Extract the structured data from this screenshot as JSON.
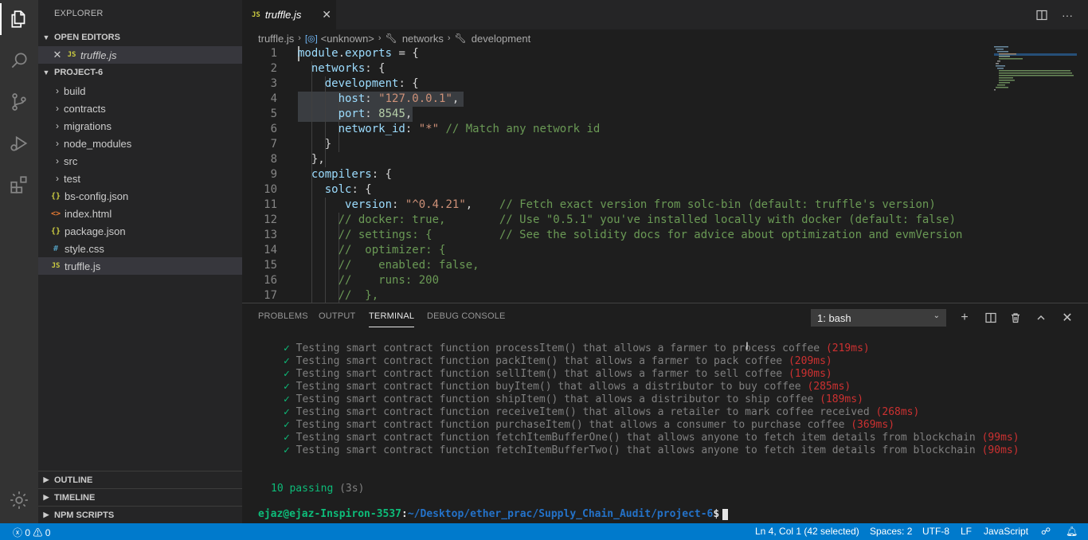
{
  "activity_bar": {
    "items": [
      "explorer-icon",
      "search-icon",
      "source-control-icon",
      "run-debug-icon",
      "extensions-icon"
    ],
    "bottom": "manage-gear-icon"
  },
  "sidebar": {
    "title": "EXPLORER",
    "open_editors": {
      "label": "OPEN EDITORS",
      "items": [
        {
          "icon": "JS",
          "name": "truffle.js"
        }
      ]
    },
    "project": {
      "label": "PROJECT-6",
      "folders": [
        "build",
        "contracts",
        "migrations",
        "node_modules",
        "src",
        "test"
      ],
      "files": [
        {
          "icon": "{}",
          "name": "bs-config.json"
        },
        {
          "icon": "<>",
          "name": "index.html"
        },
        {
          "icon": "{}",
          "name": "package.json"
        },
        {
          "icon": "#",
          "name": "style.css"
        },
        {
          "icon": "JS",
          "name": "truffle.js"
        }
      ]
    },
    "bottom_sections": [
      "OUTLINE",
      "TIMELINE",
      "NPM SCRIPTS"
    ]
  },
  "editor": {
    "tab": {
      "icon": "JS",
      "label": "truffle.js"
    },
    "breadcrumb": [
      "truffle.js",
      "<unknown>",
      "networks",
      "development"
    ],
    "lines": [
      {
        "num": "1",
        "code": "module.exports = {"
      },
      {
        "num": "2",
        "code": "  networks: {"
      },
      {
        "num": "3",
        "code": "    development: {"
      },
      {
        "num": "4",
        "code": "      host: \"127.0.0.1\","
      },
      {
        "num": "5",
        "code": "      port: 8545,"
      },
      {
        "num": "6",
        "code": "      network_id: \"*\" // Match any network id"
      },
      {
        "num": "7",
        "code": "    }"
      },
      {
        "num": "8",
        "code": "  },"
      },
      {
        "num": "9",
        "code": "  compilers: {"
      },
      {
        "num": "10",
        "code": "    solc: {"
      },
      {
        "num": "11",
        "code": "       version: \"^0.4.21\",    // Fetch exact version from solc-bin (default: truffle's version)"
      },
      {
        "num": "12",
        "code": "      // docker: true,        // Use \"0.5.1\" you've installed locally with docker (default: false)"
      },
      {
        "num": "13",
        "code": "      // settings: {          // See the solidity docs for advice about optimization and evmVersion"
      },
      {
        "num": "14",
        "code": "      //  optimizer: {"
      },
      {
        "num": "15",
        "code": "      //    enabled: false,"
      },
      {
        "num": "16",
        "code": "      //    runs: 200"
      },
      {
        "num": "17",
        "code": "      //  },"
      }
    ]
  },
  "panel": {
    "tabs": [
      "PROBLEMS",
      "OUTPUT",
      "TERMINAL",
      "DEBUG CONSOLE"
    ],
    "active_tab": "TERMINAL",
    "terminal_select": "1: bash",
    "output": [
      {
        "check": "✓",
        "text": "Testing smart contract function processItem() that allows a farmer to process coffee",
        "time": "(219ms)"
      },
      {
        "check": "✓",
        "text": "Testing smart contract function packItem() that allows a farmer to pack coffee",
        "time": "(209ms)"
      },
      {
        "check": "✓",
        "text": "Testing smart contract function sellItem() that allows a farmer to sell coffee",
        "time": "(190ms)"
      },
      {
        "check": "✓",
        "text": "Testing smart contract function buyItem() that allows a distributor to buy coffee",
        "time": "(285ms)"
      },
      {
        "check": "✓",
        "text": "Testing smart contract function shipItem() that allows a distributor to ship coffee",
        "time": "(189ms)"
      },
      {
        "check": "✓",
        "text": "Testing smart contract function receiveItem() that allows a retailer to mark coffee received",
        "time": "(268ms)"
      },
      {
        "check": "✓",
        "text": "Testing smart contract function purchaseItem() that allows a consumer to purchase coffee",
        "time": "(369ms)"
      },
      {
        "check": "✓",
        "text": "Testing smart contract function fetchItemBufferOne() that allows anyone to fetch item details from blockchain",
        "time": "(99ms)"
      },
      {
        "check": "✓",
        "text": "Testing smart contract function fetchItemBufferTwo() that allows anyone to fetch item details from blockchain",
        "time": "(90ms)"
      }
    ],
    "passing": "10 passing",
    "passing_time": "(3s)",
    "prompt_user": "ejaz@ejaz-Inspiron-3537",
    "prompt_path": "~/Desktop/ether_prac/Supply_Chain_Audit/project-6",
    "prompt_symbol": "$"
  },
  "status_bar": {
    "errors": "0",
    "warnings": "0",
    "cursor": "Ln 4, Col 1 (42 selected)",
    "spaces": "Spaces: 2",
    "encoding": "UTF-8",
    "eol": "LF",
    "language": "JavaScript"
  },
  "colors": {
    "accent": "#007acc",
    "pass_green": "#0dbc79",
    "time_red": "#cd3131",
    "path_blue": "#2472c8"
  }
}
